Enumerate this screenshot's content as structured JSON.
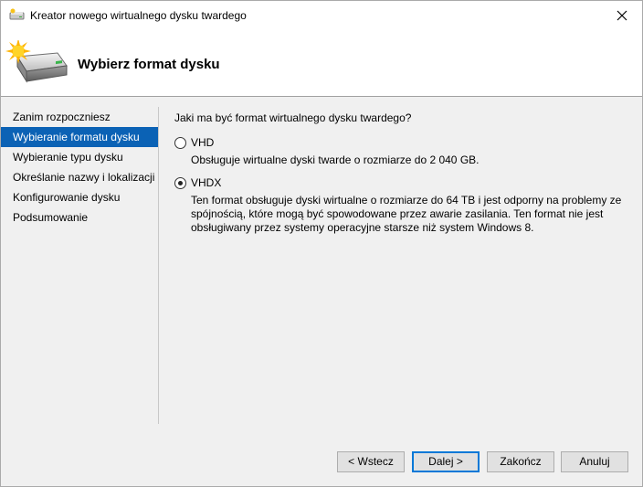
{
  "window": {
    "title": "Kreator nowego wirtualnego dysku twardego"
  },
  "header": {
    "title": "Wybierz format dysku",
    "icon": "virtual-disk-wizard-icon"
  },
  "nav": {
    "items": [
      {
        "label": "Zanim rozpoczniesz",
        "active": false
      },
      {
        "label": "Wybieranie formatu dysku",
        "active": true
      },
      {
        "label": "Wybieranie typu dysku",
        "active": false
      },
      {
        "label": "Określanie nazwy i lokalizacji",
        "active": false
      },
      {
        "label": "Konfigurowanie dysku",
        "active": false
      },
      {
        "label": "Podsumowanie",
        "active": false
      }
    ]
  },
  "content": {
    "question": "Jaki ma być format wirtualnego dysku twardego?",
    "options": [
      {
        "label": "VHD",
        "selected": false,
        "description": "Obsługuje wirtualne dyski twarde o rozmiarze do 2 040 GB."
      },
      {
        "label": "VHDX",
        "selected": true,
        "description": "Ten format obsługuje dyski wirtualne o rozmiarze do 64 TB i jest odporny na problemy ze spójnością, które mogą być spowodowane przez awarie zasilania. Ten format nie jest obsługiwany przez systemy operacyjne starsze niż system Windows 8."
      }
    ]
  },
  "buttons": {
    "back": "< Wstecz",
    "next": "Dalej >",
    "finish": "Zakończ",
    "cancel": "Anuluj"
  },
  "colors": {
    "nav_active": "#0b62b5",
    "default_button_border": "#0078d7"
  }
}
